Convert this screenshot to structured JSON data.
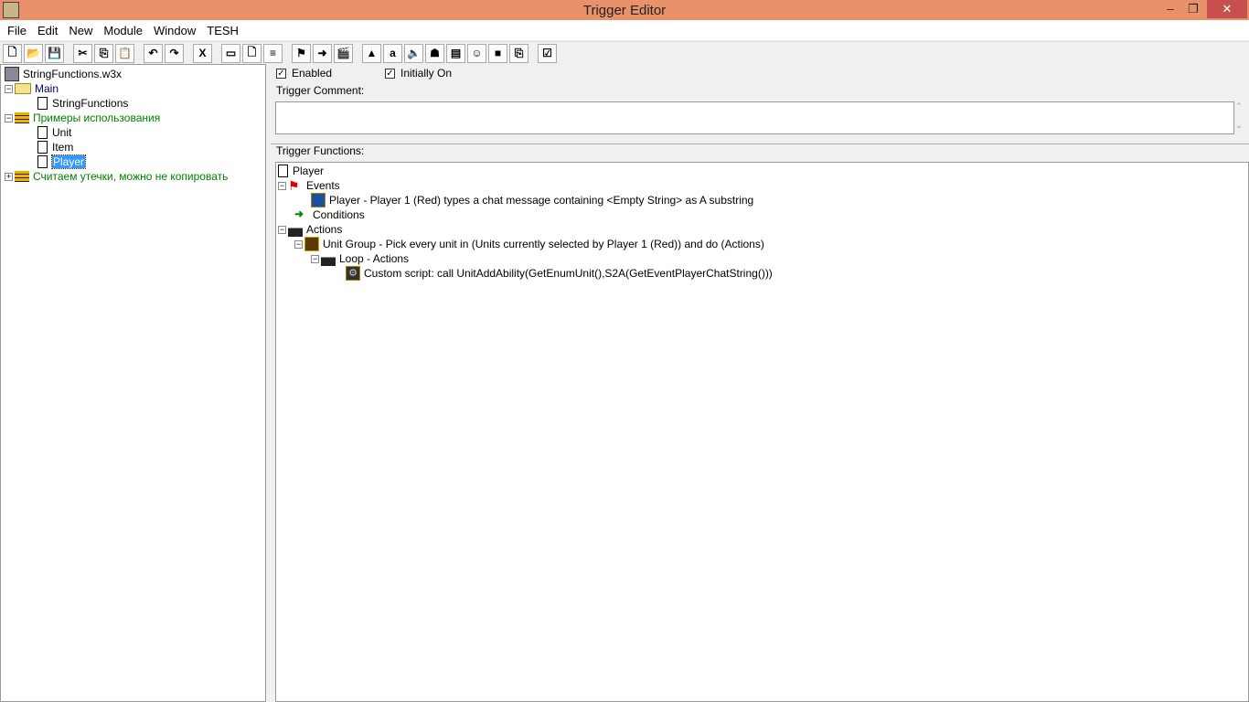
{
  "window": {
    "title": "Trigger Editor",
    "minimize": "–",
    "restore": "❐",
    "close": "✕"
  },
  "menu": [
    "File",
    "Edit",
    "New",
    "Module",
    "Window",
    "TESH"
  ],
  "toolbar": [
    {
      "icon": "new-icon",
      "g": "🗋"
    },
    {
      "icon": "open-icon",
      "g": "📂"
    },
    {
      "icon": "save-icon",
      "g": "💾"
    },
    null,
    {
      "icon": "cut-icon",
      "g": "✂"
    },
    {
      "icon": "copy-icon",
      "g": "⎘"
    },
    {
      "icon": "paste-icon",
      "g": "📋"
    },
    null,
    {
      "icon": "undo-icon",
      "g": "↶"
    },
    {
      "icon": "redo-icon",
      "g": "↷"
    },
    null,
    {
      "icon": "delete-icon",
      "g": "X"
    },
    null,
    {
      "icon": "new-category-icon",
      "g": "▭"
    },
    {
      "icon": "new-trigger-icon",
      "g": "🗋"
    },
    {
      "icon": "new-comment-icon",
      "g": "≡"
    },
    null,
    {
      "icon": "new-event-icon",
      "g": "⚑"
    },
    {
      "icon": "new-condition-icon",
      "g": "➜"
    },
    {
      "icon": "new-action-icon",
      "g": "🎬"
    },
    null,
    {
      "icon": "terrain-editor-icon",
      "g": "▲"
    },
    {
      "icon": "trigger-editor-icon",
      "g": "a"
    },
    {
      "icon": "sound-editor-icon",
      "g": "🔈"
    },
    {
      "icon": "object-editor-icon",
      "g": "☗"
    },
    {
      "icon": "campaign-editor-icon",
      "g": "▤"
    },
    {
      "icon": "ai-editor-icon",
      "g": "☺"
    },
    {
      "icon": "import-manager-icon",
      "g": "■"
    },
    {
      "icon": "object-manager-icon",
      "g": "⎘"
    },
    null,
    {
      "icon": "test-map-icon",
      "g": "☑"
    }
  ],
  "left_tree": {
    "root": "StringFunctions.w3x",
    "categories": [
      {
        "label": "Main",
        "expanded": true,
        "items": [
          "StringFunctions"
        ]
      },
      {
        "label": "Примеры использования",
        "expanded": true,
        "items": [
          "Unit",
          "Item",
          "Player"
        ]
      },
      {
        "label": "Считаем утечки, можно не копировать",
        "expanded": false,
        "items": []
      }
    ],
    "selected": "Player"
  },
  "trigger": {
    "enabled_label": "Enabled",
    "enabled": true,
    "initially_on_label": "Initially On",
    "initially_on": true,
    "comment_label": "Trigger Comment:",
    "comment_value": "",
    "functions_label": "Trigger Functions:",
    "name": "Player",
    "events_label": "Events",
    "event": "Player - Player 1 (Red) types a chat message containing <Empty String> as A substring",
    "conditions_label": "Conditions",
    "actions_label": "Actions",
    "action": "Unit Group - Pick every unit in (Units currently selected by Player 1 (Red)) and do (Actions)",
    "loop_label": "Loop - Actions",
    "script": "Custom script:   call UnitAddAbility(GetEnumUnit(),S2A(GetEventPlayerChatString()))"
  }
}
